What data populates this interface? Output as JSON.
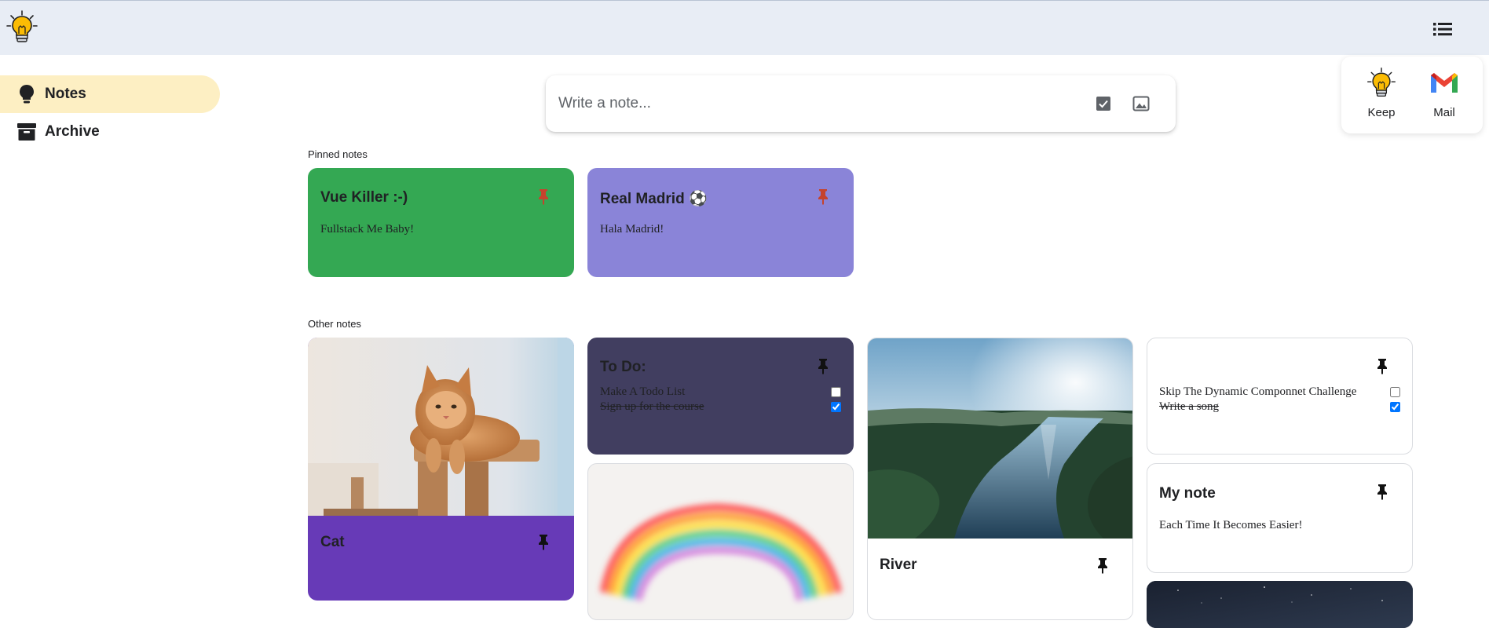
{
  "header": {
    "menu_icon": "list-icon",
    "logo_icon": "lightbulb-icon"
  },
  "sidebar": {
    "items": [
      {
        "label": "Notes",
        "icon": "lightbulb-icon",
        "active": true
      },
      {
        "label": "Archive",
        "icon": "archive-icon",
        "active": false
      }
    ]
  },
  "composer": {
    "placeholder": "Write a note...",
    "checklist_icon": "checkbox-icon",
    "image_icon": "image-icon"
  },
  "apps": [
    {
      "label": "Keep",
      "icon": "keep-lightbulb-icon"
    },
    {
      "label": "Mail",
      "icon": "gmail-icon"
    }
  ],
  "sections": {
    "pinned": "Pinned notes",
    "other": "Other notes"
  },
  "pinned_notes": [
    {
      "title": "Vue Killer :-)",
      "text": "Fullstack Me Baby!",
      "color": "#34a853"
    },
    {
      "title": "Real Madrid ⚽",
      "text": "Hala Madrid!",
      "color": "#8a84d8"
    }
  ],
  "other_notes": {
    "cat": {
      "title": "Cat",
      "image": "cat-photo",
      "color": "#673ab7"
    },
    "todo": {
      "title": "To Do:",
      "color": "#413e60",
      "items": [
        {
          "text": "Make A Todo List",
          "done": false
        },
        {
          "text": "Sign up for the course",
          "done": true
        }
      ]
    },
    "rainbow": {
      "image": "rainbow-image",
      "color": "#f4f2f0"
    },
    "river": {
      "title": "River",
      "image": "river-photo",
      "color": "#ffffff"
    },
    "checklist": {
      "items": [
        {
          "text": "Skip The Dynamic Componnet Challenge",
          "done": false
        },
        {
          "text": "Write a song",
          "done": true
        }
      ]
    },
    "my_note": {
      "title": "My note",
      "text": "Each Time It Becomes Easier!"
    },
    "night_sky": {
      "image": "night-sky-photo"
    }
  },
  "colors": {
    "pin_pinned": "#c5432d",
    "pin_default": "#111111",
    "topbar": "#e8edf5",
    "sidebar_active": "#fdefc3"
  }
}
